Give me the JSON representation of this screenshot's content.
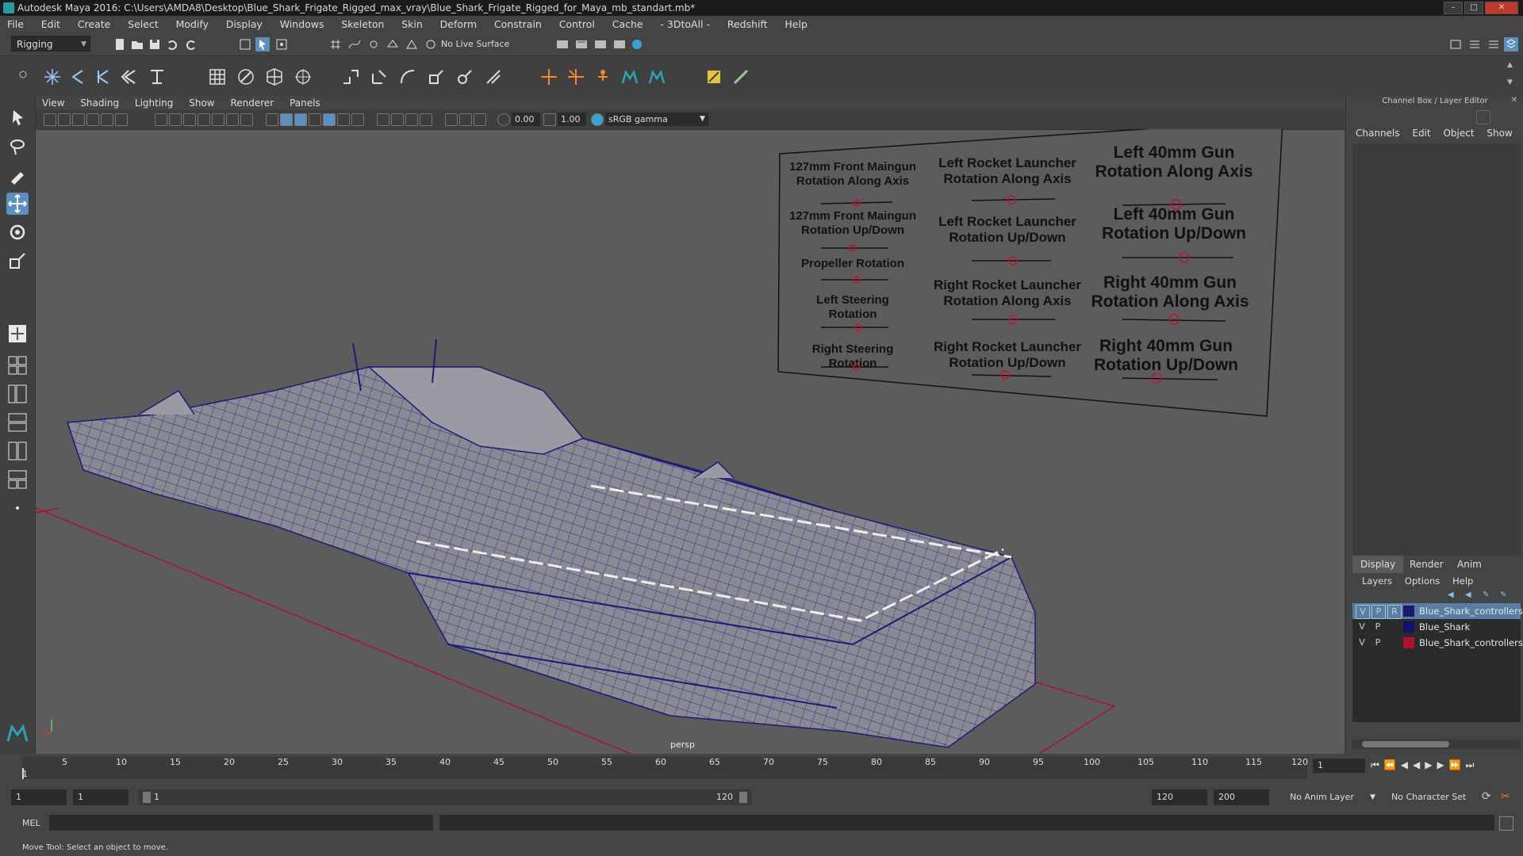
{
  "window": {
    "title": "Autodesk Maya 2016: C:\\Users\\AMDA8\\Desktop\\Blue_Shark_Frigate_Rigged_max_vray\\Blue_Shark_Frigate_Rigged_for_Maya_mb_standart.mb*"
  },
  "menubar": [
    "File",
    "Edit",
    "Create",
    "Select",
    "Modify",
    "Display",
    "Windows",
    "Skeleton",
    "Skin",
    "Deform",
    "Constrain",
    "Control",
    "Cache",
    "- 3DtoAll -",
    "Redshift",
    "Help"
  ],
  "statusline": {
    "mode": "Rigging",
    "live_surface": "No Live Surface"
  },
  "viewport": {
    "menu": [
      "View",
      "Shading",
      "Lighting",
      "Show",
      "Renderer",
      "Panels"
    ],
    "exposure": "0.00",
    "gamma": "1.00",
    "color_space": "sRGB gamma",
    "camera": "persp"
  },
  "control_board": {
    "labels": [
      "127mm Front Maingun\nRotation Along Axis",
      "127mm Front Maingun\nRotation Up/Down",
      "Propeller Rotation",
      "Left Steering\nRotation",
      "Right Steering\nRotation",
      "Left Rocket Launcher\nRotation Along Axis",
      "Left Rocket Launcher\nRotation Up/Down",
      "Right Rocket Launcher\nRotation Along Axis",
      "Right Rocket Launcher\nRotation Up/Down",
      "Left 40mm Gun\nRotation Along Axis",
      "Left 40mm Gun\nRotation Up/Down",
      "Right 40mm Gun\nRotation Along Axis",
      "Right 40mm Gun\nRotation Up/Down"
    ]
  },
  "channel_box": {
    "header": "Channel Box / Layer Editor",
    "tabs": [
      "Channels",
      "Edit",
      "Object",
      "Show"
    ]
  },
  "layer_editor": {
    "tabs": [
      "Display",
      "Render",
      "Anim"
    ],
    "menu": [
      "Layers",
      "Options",
      "Help"
    ],
    "layers": [
      {
        "v": "V",
        "p": "P",
        "r": "R",
        "name": "Blue_Shark_controllers",
        "color": "#1a1a6a",
        "selected": true
      },
      {
        "v": "V",
        "p": "P",
        "r": "",
        "name": "Blue_Shark",
        "color": "#12126e",
        "selected": false
      },
      {
        "v": "V",
        "p": "P",
        "r": "",
        "name": "Blue_Shark_controllers",
        "color": "#b0122e",
        "selected": false
      }
    ]
  },
  "timeline": {
    "ticks": [
      "1",
      "5",
      "10",
      "15",
      "20",
      "25",
      "30",
      "35",
      "40",
      "45",
      "50",
      "55",
      "60",
      "65",
      "70",
      "75",
      "80",
      "85",
      "90",
      "95",
      "100",
      "105",
      "110",
      "115",
      "120"
    ],
    "current_frame": "1"
  },
  "range": {
    "start": "1",
    "playback_start": "1",
    "slider_start": "1",
    "slider_end": "120",
    "playback_end": "120",
    "end": "200",
    "anim_layer": "No Anim Layer",
    "character_set": "No Character Set"
  },
  "commandline": {
    "language": "MEL"
  },
  "helpline": {
    "text": "Move Tool: Select an object to move."
  }
}
